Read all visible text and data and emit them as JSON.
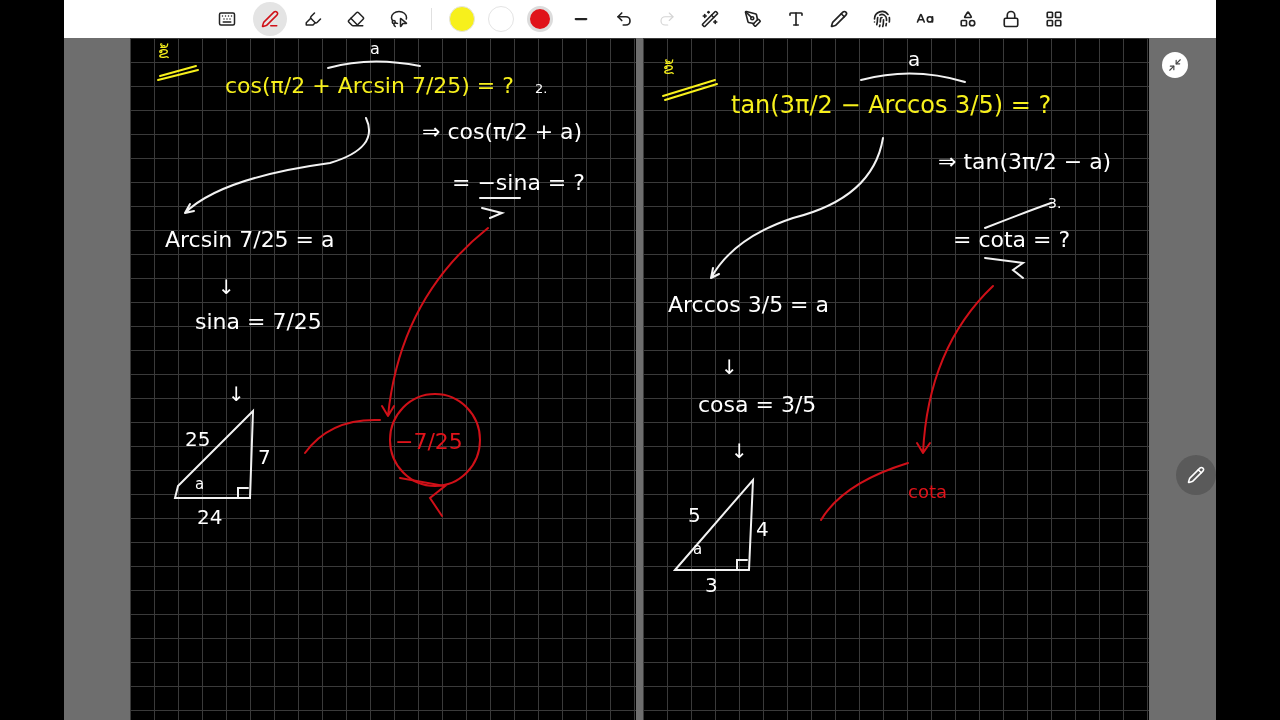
{
  "toolbar": {
    "tools": [
      {
        "kind": "keyboard",
        "selected": false,
        "disabled": false
      },
      {
        "kind": "pen",
        "selected": true,
        "disabled": false
      },
      {
        "kind": "highlighter",
        "selected": false,
        "disabled": false
      },
      {
        "kind": "eraser",
        "selected": false,
        "disabled": false
      },
      {
        "kind": "lasso",
        "selected": false,
        "disabled": false
      }
    ],
    "swatches": [
      {
        "color": "#f7f01c",
        "selected": false
      },
      {
        "color": "#ffffff",
        "selected": false
      },
      {
        "color": "#e0131a",
        "selected": true
      }
    ],
    "actions": [
      {
        "kind": "stroke",
        "disabled": false
      },
      {
        "kind": "undo",
        "disabled": false
      },
      {
        "kind": "redo",
        "disabled": true
      },
      {
        "kind": "magic-pen",
        "disabled": false
      },
      {
        "kind": "shape-pen",
        "disabled": false
      },
      {
        "kind": "text-pen",
        "disabled": false
      },
      {
        "kind": "marker",
        "disabled": false
      },
      {
        "kind": "gesture",
        "disabled": false
      },
      {
        "kind": "text-size",
        "disabled": false
      },
      {
        "kind": "shapes",
        "disabled": false
      },
      {
        "kind": "lock",
        "disabled": false
      },
      {
        "kind": "apps",
        "disabled": false
      }
    ]
  },
  "pages": [
    {
      "items": [
        {
          "text": "ຂໍ້",
          "color": "#f7f01c"
        },
        {
          "text": "a",
          "color": "#ffffff"
        },
        {
          "text": "cos(π/2 + Arcsin 7/25) = ?",
          "color": "#f7f01c"
        },
        {
          "text": "2.",
          "color": "#ffffff"
        },
        {
          "text": "⇒ cos(π/2 + a)",
          "color": "#ffffff"
        },
        {
          "text": "= −sina = ?",
          "color": "#ffffff"
        },
        {
          "text": "Arcsin 7/25 = a",
          "color": "#ffffff"
        },
        {
          "text": "↓",
          "color": "#ffffff"
        },
        {
          "text": "sina = 7/25",
          "color": "#ffffff"
        },
        {
          "text": "↓",
          "color": "#ffffff"
        },
        {
          "text": "25",
          "color": "#ffffff"
        },
        {
          "text": "7",
          "color": "#ffffff"
        },
        {
          "text": "a",
          "color": "#ffffff"
        },
        {
          "text": "24",
          "color": "#ffffff"
        },
        {
          "text": "−7/25",
          "color": "#e0131a"
        }
      ]
    },
    {
      "items": [
        {
          "text": "ຂໍ້",
          "color": "#f7f01c"
        },
        {
          "text": "a",
          "color": "#ffffff"
        },
        {
          "text": "tan(3π/2 − Arccos 3/5) = ?",
          "color": "#f7f01c"
        },
        {
          "text": "⇒ tan(3π/2 − a)",
          "color": "#ffffff"
        },
        {
          "text": "3.",
          "color": "#ffffff"
        },
        {
          "text": "= cota = ?",
          "color": "#ffffff"
        },
        {
          "text": "Arccos 3/5 = a",
          "color": "#ffffff"
        },
        {
          "text": "↓",
          "color": "#ffffff"
        },
        {
          "text": "cosa = 3/5",
          "color": "#ffffff"
        },
        {
          "text": "↓",
          "color": "#ffffff"
        },
        {
          "text": "5",
          "color": "#ffffff"
        },
        {
          "text": "4",
          "color": "#ffffff"
        },
        {
          "text": "a",
          "color": "#ffffff"
        },
        {
          "text": "3",
          "color": "#ffffff"
        },
        {
          "text": "cota",
          "color": "#e0131a"
        }
      ]
    }
  ]
}
